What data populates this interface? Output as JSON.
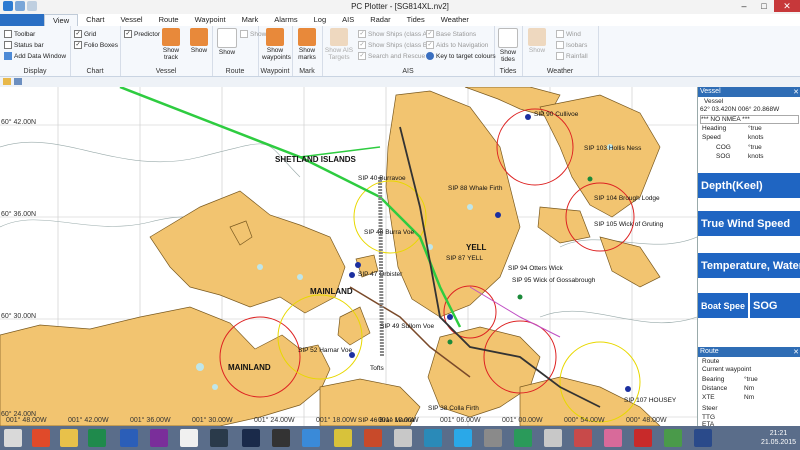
{
  "window": {
    "title": "PC Plotter - [SG814XL.nv2]"
  },
  "menu": {
    "items": [
      "View",
      "Chart",
      "Vessel",
      "Route",
      "Waypoint",
      "Mark",
      "Alarms",
      "Log",
      "AIS",
      "Radar",
      "Tides",
      "Weather"
    ],
    "active": "View"
  },
  "ribbon": {
    "display": {
      "label": "Display",
      "toolbar": "Toolbar",
      "status_bar": "Status bar",
      "add_data_window": "Add Data Window"
    },
    "chart": {
      "label": "Chart",
      "grid": "Grid",
      "folio_boxes": "Folio Boxes"
    },
    "vessel": {
      "label": "Vessel",
      "predictor": "Predictor",
      "show_track": "Show track",
      "show": "Show"
    },
    "route": {
      "label": "Route",
      "show_plan": "Show Plan",
      "show": "Show"
    },
    "waypoint": {
      "label": "Waypoint",
      "show_waypoints": "Show waypoints"
    },
    "mark": {
      "label": "Mark",
      "show_marks": "Show marks"
    },
    "ais": {
      "label": "AIS",
      "show_ais_targets": "Show AIS Targets",
      "ships_a": "Show Ships (class A)",
      "ships_b": "Show Ships (class B)",
      "sar": "Search and Rescue",
      "base_stations": "Base Stations",
      "aids": "Aids to Navigation",
      "key": "Key to target colours"
    },
    "tides": {
      "label": "Tides",
      "show_tides": "Show tides"
    },
    "weather": {
      "label": "Weather",
      "show": "Show",
      "wind": "Wind",
      "isobars": "Isobars",
      "rainfall": "Rainfall"
    }
  },
  "map": {
    "latitudes": [
      "60° 42.00N",
      "60° 36.00N",
      "60° 30.00N",
      "60° 24.00N"
    ],
    "longitudes": [
      "001° 48.00W",
      "001° 42.00W",
      "001° 36.00W",
      "001° 30.00W",
      "001° 24.00W",
      "001° 18.00W",
      "001° 12.00W",
      "001° 06.00W",
      "001° 00.00W",
      "000° 54.00W",
      "000° 48.00W"
    ],
    "labels": [
      "SHETLAND ISLANDS",
      "MAINLAND",
      "MAINLAND",
      "YELL",
      "SIP 87 YELL",
      "SIP 88 Whale Firth",
      "SIP 95 Wick of Gossabrough",
      "SIP 94 Otters Wick",
      "SIP 48 Burra Voe",
      "SIP 47 Orbister",
      "SIP 49 Sullom Voe",
      "SIP 52 Harnar Voe",
      "SIP 105 Wick of Gruting",
      "SIP 104 Brough Lodge",
      "SIP 103 Hollis Ness",
      "SIP 107 HOUSEY",
      "SIP 46 Brae Marina",
      "SIP 38 Colla Firth",
      "SIP 40 Burravoe",
      "Tofts",
      "SIP 90 Cullivoe"
    ]
  },
  "vessel_panel": {
    "header": "Vessel",
    "vessel_label": "Vessel",
    "position": "62° 03.420N     006° 20.868W",
    "nmea": "*** NO NMEA ***",
    "rows": [
      [
        "Heading",
        "°true"
      ],
      [
        "Speed",
        "knots"
      ],
      [
        "COG",
        "°true"
      ],
      [
        "SOG",
        "knots"
      ]
    ],
    "big": [
      "Depth(Keel)",
      "True Wind Speed",
      "Temperature, Water"
    ],
    "boat_speed": "Boat Spee",
    "sog": "SOG"
  },
  "route_panel": {
    "header": "Route",
    "route_label": "Route",
    "rows": [
      [
        "Current waypoint",
        ""
      ],
      [
        "Bearing",
        "°true"
      ],
      [
        "Distance",
        "Nm"
      ],
      [
        "XTE",
        "Nm"
      ],
      [
        "Steer",
        ""
      ],
      [
        "TTG",
        ""
      ],
      [
        "ETA",
        ""
      ]
    ]
  },
  "clock": {
    "time": "21:21",
    "date": "21.05.2015"
  },
  "colors": {
    "land": "#f2c470",
    "sea": "#ffffff",
    "ribbon_bg": "#f5f8fc",
    "accent": "#1f65c2",
    "track": "#2ecc40",
    "range_red": "#d22",
    "range_yellow": "#e8d800"
  }
}
